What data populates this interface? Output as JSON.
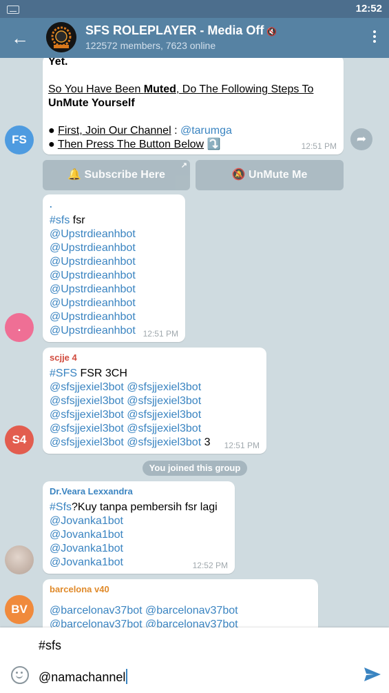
{
  "status_bar": {
    "time": "12:52"
  },
  "header": {
    "title": "SFS ROLEPLAYER - Media Off",
    "subtitle": "122572 members, 7623 online"
  },
  "messages": [
    {
      "lines": {
        "l1": "Yet.",
        "l2a": "So You Have Been ",
        "l2b": "Muted",
        "l2c": ", Do The Following Steps To",
        "l3": "UnMute Yourself",
        "l4a": "● ",
        "l4b": "First, Join Our Channel",
        "l4c": " : ",
        "l4d": "@tarumga",
        "l5a": "● ",
        "l5b": "Then Press The Button Below",
        "l5c": " ⤵️"
      },
      "time": "12:51 PM",
      "avatar_initials": "FS",
      "buttons": {
        "subscribe": "🔔 Subscribe Here",
        "unmute": "🔕 UnMute Me"
      }
    },
    {
      "sender": ".",
      "avatar_initials": ".",
      "hashtag": "#sfs",
      "text_after_tag": " fsr",
      "mentions": [
        "@Upstrdieanhbot",
        "@Upstrdieanhbot",
        "@Upstrdieanhbot",
        "@Upstrdieanhbot",
        "@Upstrdieanhbot",
        "@Upstrdieanhbot",
        "@Upstrdieanhbot",
        "@Upstrdieanhbot"
      ],
      "time": "12:51 PM"
    },
    {
      "sender": "scjje 4",
      "avatar_initials": "S4",
      "hashtag": "#SFS",
      "text_after_tag": " FSR 3CH",
      "mention_rows": [
        [
          "@sfsjjexiel3bot",
          "@sfsjjexiel3bot"
        ],
        [
          "@sfsjjexiel3bot",
          "@sfsjjexiel3bot"
        ],
        [
          "@sfsjjexiel3bot",
          "@sfsjjexiel3bot"
        ],
        [
          "@sfsjjexiel3bot",
          "@sfsjjexiel3bot"
        ],
        [
          "@sfsjjexiel3bot",
          "@sfsjjexiel3bot"
        ]
      ],
      "trailing_text": " 3",
      "time": "12:51 PM"
    },
    {
      "service_text": "You joined this group"
    },
    {
      "sender": "Dr.Veara Lexxandra",
      "hashtag": "#Sfs",
      "text_after_tag": "?Kuy tanpa pembersih fsr lagi",
      "mentions": [
        "@Jovanka1bot",
        "@Jovanka1bot",
        "@Jovanka1bot",
        "@Jovanka1bot"
      ],
      "time": "12:52 PM"
    },
    {
      "sender": "barcelona v40",
      "avatar_initials": "BV",
      "mention_rows": [
        [
          "@barcelonav37bot",
          "@barcelonav37bot"
        ],
        [
          "@barcelonav37bot",
          "@barcelonav37bot"
        ]
      ]
    }
  ],
  "input": {
    "line1": "#sfs",
    "line2": "@namachannel"
  },
  "colors": {
    "header": "#5682a3",
    "status_bar": "#4c6e8d",
    "link": "#3a84c1",
    "sender_dot": "#3a84c1",
    "sender_scjje": "#d14b3e",
    "sender_veara": "#3a84c1",
    "sender_barcelona": "#e08a2a"
  }
}
